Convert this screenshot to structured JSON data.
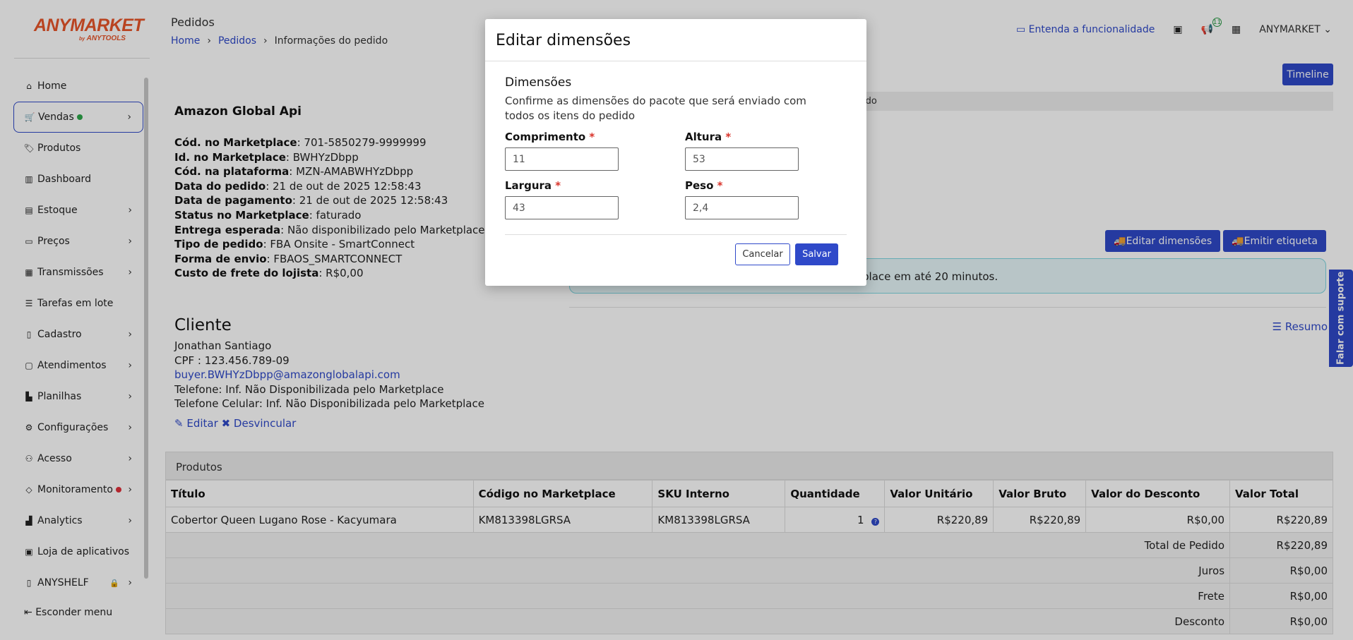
{
  "brand": {
    "name": "ANYMARKET",
    "by": "by",
    "sub": "ANYTOOLS"
  },
  "sidebar": {
    "items": [
      {
        "label": "Home",
        "icon": "home-icon"
      },
      {
        "label": "Vendas",
        "icon": "cart-icon",
        "dot_color": "#2ea84a"
      },
      {
        "label": "Produtos",
        "icon": "tag-icon"
      },
      {
        "label": "Dashboard",
        "icon": "bar-chart-icon"
      },
      {
        "label": "Estoque",
        "icon": "box-icon"
      },
      {
        "label": "Preços",
        "icon": "money-icon"
      },
      {
        "label": "Transmissões",
        "icon": "store-icon"
      },
      {
        "label": "Tarefas em lote",
        "icon": "list-icon"
      },
      {
        "label": "Cadastro",
        "icon": "clipboard-icon"
      },
      {
        "label": "Atendimentos",
        "icon": "chat-icon"
      },
      {
        "label": "Planilhas",
        "icon": "spreadsheet-icon"
      },
      {
        "label": "Configurações",
        "icon": "gear-icon"
      },
      {
        "label": "Acesso",
        "icon": "users-icon"
      },
      {
        "label": "Monitoramento",
        "icon": "diamond-icon",
        "dot_color": "#e0303a"
      },
      {
        "label": "Analytics",
        "icon": "analytics-icon"
      },
      {
        "label": "Loja de aplicativos",
        "icon": "app-store-icon"
      },
      {
        "label": "ANYSHELF",
        "icon": "shelf-icon"
      }
    ],
    "hide_menu": "Esconder menu"
  },
  "header": {
    "title": "Pedidos",
    "breadcrumb": [
      "Home",
      "Pedidos",
      "Informações do pedido"
    ],
    "help_link": "Entenda a funcionalidade",
    "notifications_count": "11",
    "user": "ANYMARKET",
    "timeline": "Timeline"
  },
  "order": {
    "marketplace_name": "Amazon Global Api",
    "fields": [
      {
        "label": "Cód. no Marketplace",
        "value": ": 701-5850279-9999999"
      },
      {
        "label": "Id. no Marketplace",
        "value": ": BWHYzDbpp"
      },
      {
        "label": "Cód. na plataforma",
        "value": ": MZN-AMABWHYzDbpp"
      },
      {
        "label": "Data do pedido",
        "value": ": 21 de out de 2025 12:58:43"
      },
      {
        "label": "Data de pagamento",
        "value": ": 21 de out de 2025 12:58:43"
      },
      {
        "label": "Status no Marketplace",
        "value": ": faturado"
      },
      {
        "label": "Entrega esperada",
        "value": ": Não disponibilizado pelo Marketplace."
      },
      {
        "label": "Tipo de pedido",
        "value": ": FBA Onsite - SmartConnect"
      },
      {
        "label": "Forma de envio",
        "value": ": FBAOS_SMARTCONNECT"
      },
      {
        "label": "Custo de frete do lojista",
        "value": ": R$0,00"
      }
    ]
  },
  "client": {
    "title": "Cliente",
    "name": "Jonathan Santiago",
    "cpf": "CPF : 123.456.789-09",
    "email": "buyer.BWHYzDbpp@amazonglobalapi.com",
    "phone": "Telefone: Inf. Não Disponibilizada pelo Marketplace",
    "mobile": "Telefone Celular: Inf. Não Disponibilizada pelo Marketplace",
    "edit": "Editar",
    "unlink": "Desvincular"
  },
  "shipping": {
    "head_text": "ído",
    "edit_dimensions": "Editar dimensões",
    "issue_label": "Emitir etiqueta",
    "info_text": "place em até 20 minutos.",
    "summary": "Resumo"
  },
  "products": {
    "title": "Produtos",
    "columns": [
      "Título",
      "Código no Marketplace",
      "SKU Interno",
      "Quantidade",
      "Valor Unitário",
      "Valor Bruto",
      "Valor do Desconto",
      "Valor Total"
    ],
    "rows": [
      {
        "title": "Cobertor Queen Lugano Rose - Kacyumara",
        "code": "KM813398LGRSA",
        "sku": "KM813398LGRSA",
        "qty": "1",
        "unit": "R$220,89",
        "gross": "R$220,89",
        "discount": "R$0,00",
        "total": "R$220,89"
      }
    ],
    "totals": [
      {
        "label": "Total de Pedido",
        "value": "R$220,89"
      },
      {
        "label": "Juros",
        "value": "R$0,00"
      },
      {
        "label": "Frete",
        "value": "R$0,00"
      },
      {
        "label": "Desconto",
        "value": "R$0,00"
      }
    ]
  },
  "modal": {
    "title": "Editar dimensões",
    "section": "Dimensões",
    "description": "Confirme as dimensões do pacote que será enviado com todos os itens do pedido",
    "fields": {
      "length": {
        "label": "Comprimento",
        "value": "11"
      },
      "height": {
        "label": "Altura",
        "value": "53"
      },
      "width": {
        "label": "Largura",
        "value": "43"
      },
      "weight": {
        "label": "Peso",
        "value": "2,4"
      }
    },
    "required_mark": "*",
    "cancel": "Cancelar",
    "save": "Salvar"
  },
  "support": "Falar com suporte",
  "colors": {
    "accent": "#2f49c9",
    "brand": "#e8552a",
    "overlay": "rgba(0,0,0,0.2)"
  }
}
